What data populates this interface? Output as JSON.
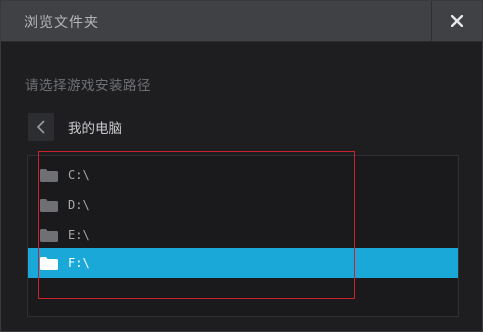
{
  "window": {
    "title": "浏览文件夹",
    "close_icon": "close-icon"
  },
  "prompt": "请选择游戏安装路径",
  "navigation": {
    "back_icon": "chevron-left-icon",
    "current_location": "我的电脑"
  },
  "drives": [
    {
      "label": "C:\\",
      "icon": "folder-icon",
      "selected": false
    },
    {
      "label": "D:\\",
      "icon": "folder-icon",
      "selected": false
    },
    {
      "label": "E:\\",
      "icon": "folder-icon",
      "selected": false
    },
    {
      "label": "F:\\",
      "icon": "folder-icon",
      "selected": true
    }
  ],
  "colors": {
    "selection": "#1aa8d9",
    "annotation": "#c8232b"
  }
}
